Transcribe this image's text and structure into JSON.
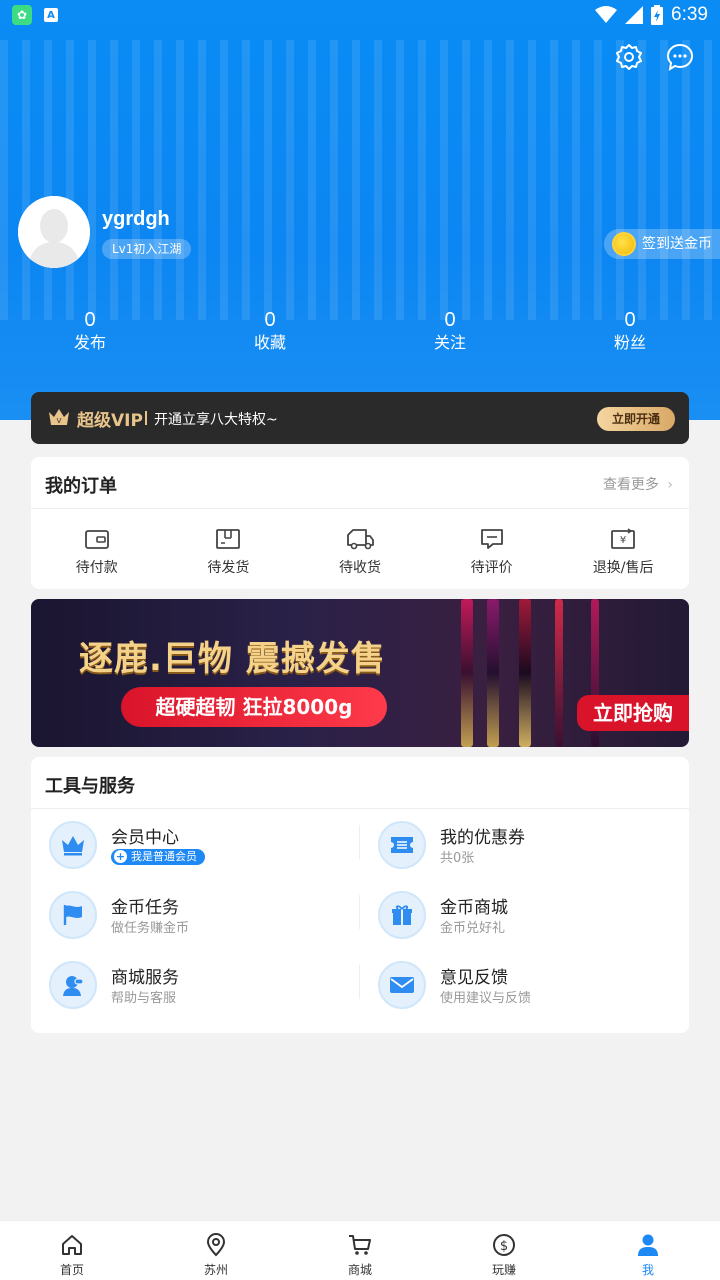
{
  "status_bar": {
    "time": "6:39"
  },
  "profile": {
    "username": "ygrdgh",
    "level": "Lv1初入江湖",
    "signin_label": "签到送金币"
  },
  "stats": [
    {
      "value": "0",
      "label": "发布"
    },
    {
      "value": "0",
      "label": "收藏"
    },
    {
      "value": "0",
      "label": "关注"
    },
    {
      "value": "0",
      "label": "粉丝"
    }
  ],
  "vip": {
    "title": "超级VIP",
    "desc": "开通立享八大特权~",
    "button": "立即开通"
  },
  "orders": {
    "title": "我的订单",
    "more": "查看更多",
    "items": [
      {
        "label": "待付款",
        "icon": "wallet-icon"
      },
      {
        "label": "待发货",
        "icon": "box-icon"
      },
      {
        "label": "待收货",
        "icon": "truck-icon"
      },
      {
        "label": "待评价",
        "icon": "comment-icon"
      },
      {
        "label": "退换/售后",
        "icon": "refund-icon"
      }
    ]
  },
  "banner": {
    "title": "逐鹿.巨物 震撼发售",
    "pill": "超硬超韧 狂拉8000g",
    "button": "立即抢购"
  },
  "tools": {
    "title": "工具与服务",
    "items": [
      {
        "name": "会员中心",
        "sub": "我是普通会员",
        "icon": "crown-icon"
      },
      {
        "name": "我的优惠券",
        "sub": "共0张",
        "icon": "coupon-icon"
      },
      {
        "name": "金币任务",
        "sub": "做任务赚金币",
        "icon": "flag-icon"
      },
      {
        "name": "金币商城",
        "sub": "金币兑好礼",
        "icon": "gift-icon"
      },
      {
        "name": "商城服务",
        "sub": "帮助与客服",
        "icon": "service-icon"
      },
      {
        "name": "意见反馈",
        "sub": "使用建议与反馈",
        "icon": "mail-icon"
      }
    ]
  },
  "tabbar": [
    {
      "label": "首页",
      "icon": "home-icon"
    },
    {
      "label": "苏州",
      "icon": "location-icon"
    },
    {
      "label": "商城",
      "icon": "cart-icon"
    },
    {
      "label": "玩赚",
      "icon": "dollar-icon"
    },
    {
      "label": "我",
      "icon": "user-icon",
      "active": true
    }
  ],
  "colors": {
    "primary": "#1e88f5",
    "hero": "#0a8cf4",
    "vip_gold": "#e8c48a"
  }
}
